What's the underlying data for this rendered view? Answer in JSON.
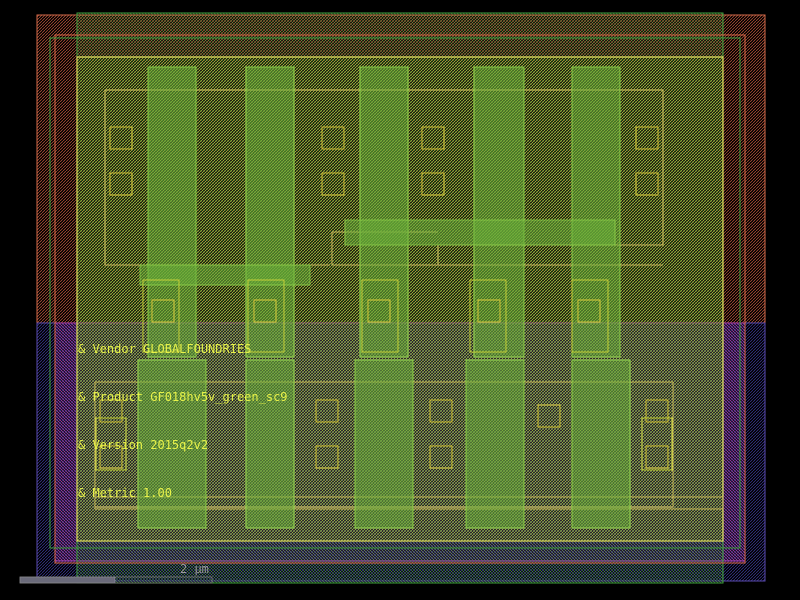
{
  "annotations": [
    {
      "text": "& Vendor GLOBALFOUNDRIES"
    },
    {
      "text": "& Product GF018hv5v_green_sc9"
    },
    {
      "text": "& Version 2015q2v2"
    },
    {
      "text": "& Metric 1.00"
    }
  ],
  "scale_bar": {
    "label": "2 µm"
  },
  "colors": {
    "nwell": "#d46a4a",
    "pwell": "#4a3aa0",
    "comp": "#3fa03f",
    "poly": "#8fd14a",
    "metal": "#c8d23a",
    "contact": "#d8c83a",
    "boundary": "#e0e060",
    "implant": "#b040b0"
  }
}
